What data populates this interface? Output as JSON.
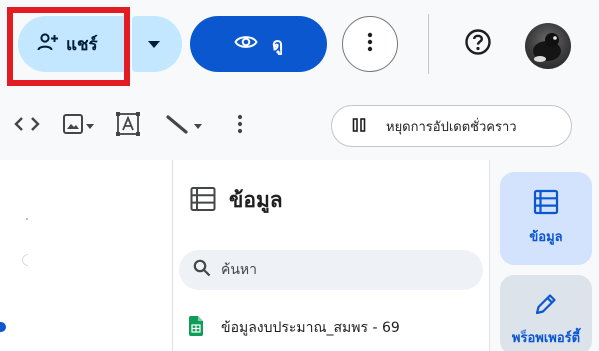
{
  "header": {
    "share_label": "แชร์",
    "view_label": "ดู",
    "icons": {
      "share": "person-add-icon",
      "share_dropdown": "caret-down-icon",
      "view": "eye-icon",
      "more": "more-vert-icon",
      "help": "help-icon",
      "avatar": "user-avatar"
    }
  },
  "toolbar": {
    "pause_label": "หยุดการอัปเดตชั่วคราว",
    "icons": [
      "code-icon",
      "image-icon",
      "text-box-icon",
      "line-icon",
      "more-vert-icon",
      "pause-icon"
    ]
  },
  "data_panel": {
    "title": "ข้อมูล",
    "search_placeholder": "ค้นหา",
    "files": [
      {
        "name": "ข้อมูลงบประมาณ_สมพร - 69",
        "icon": "sheets-icon"
      }
    ]
  },
  "rail": {
    "data_label": "ข้อมูล",
    "properties_label": "พร็อพเพอร์ตี้"
  },
  "colors": {
    "share_bg": "#c2e7ff",
    "primary": "#0b57d0",
    "highlight": "#e31b23",
    "sheets_green": "#0f9d58"
  }
}
